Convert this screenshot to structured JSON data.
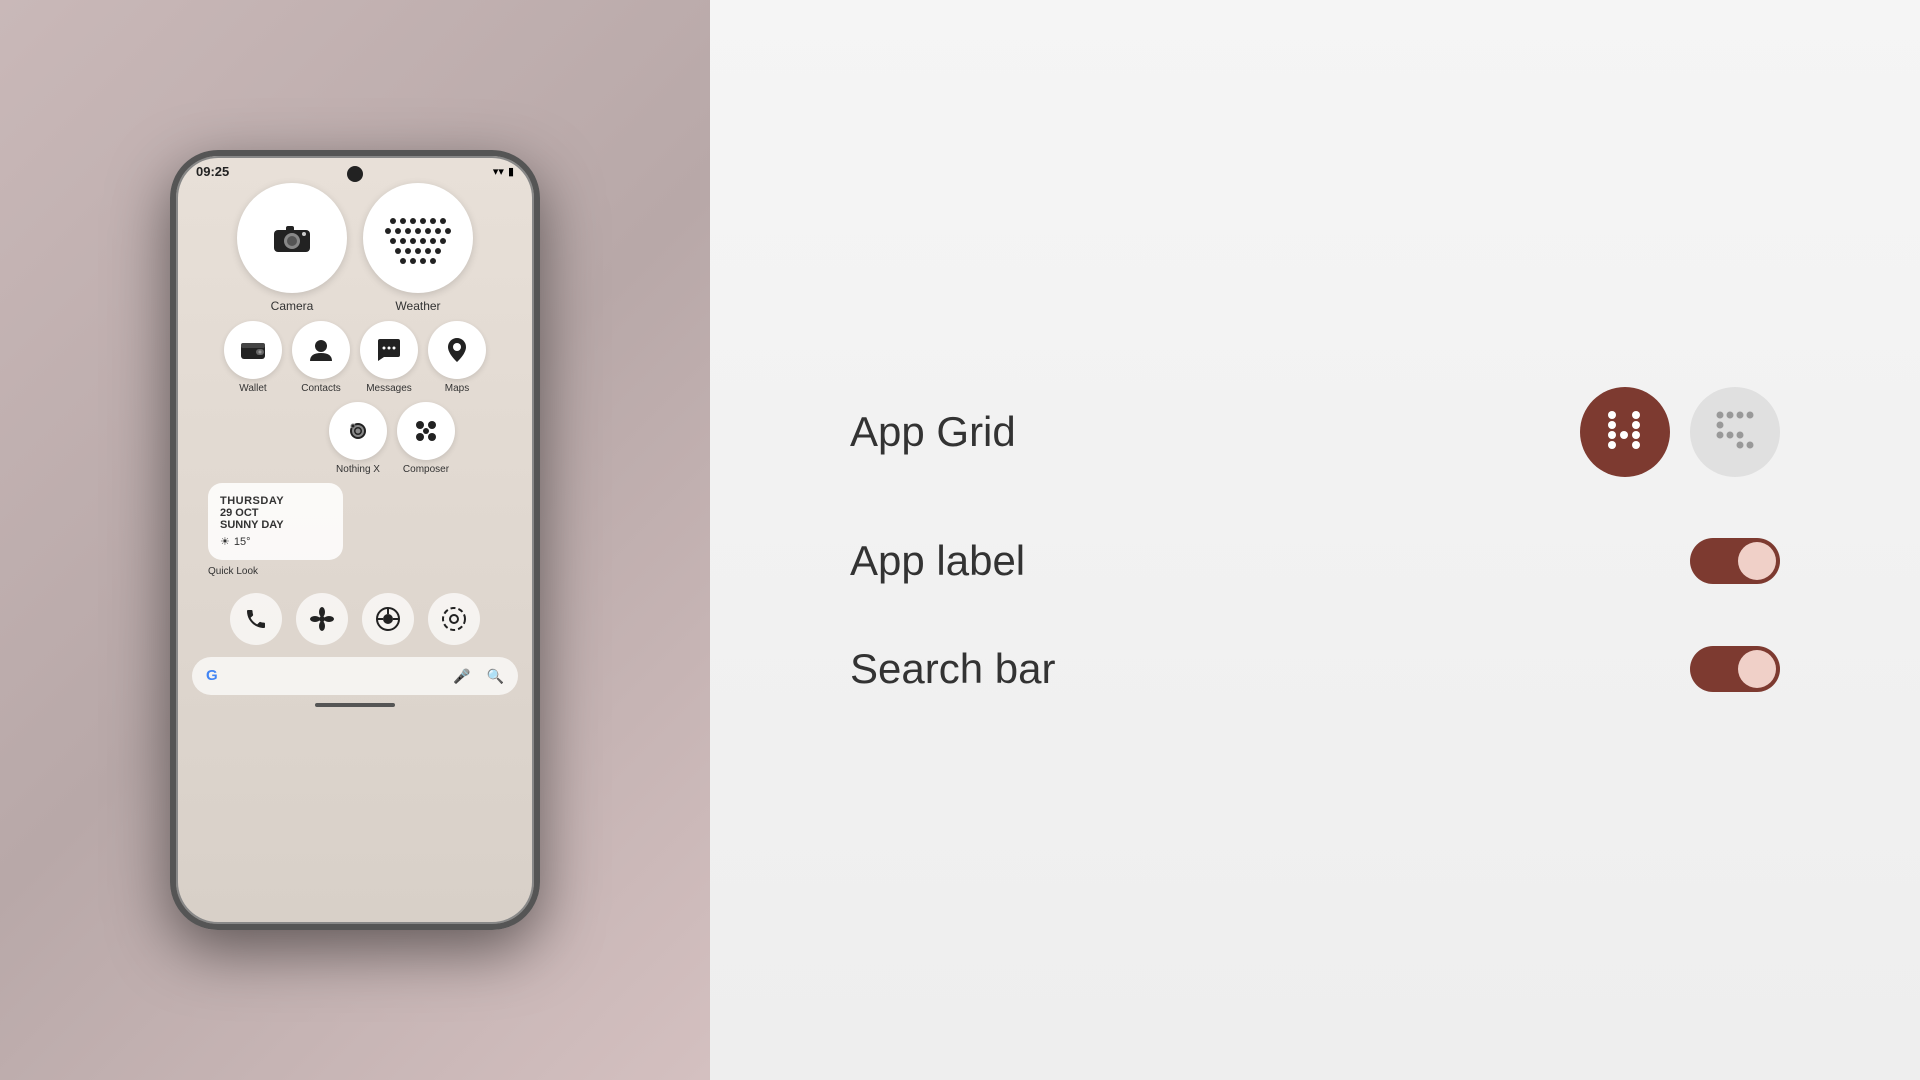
{
  "phone": {
    "time": "09:25",
    "status": {
      "wifi": "▾",
      "battery": "▮"
    },
    "large_apps": [
      {
        "name": "Camera",
        "icon": "camera"
      },
      {
        "name": "Weather",
        "icon": "weather"
      }
    ],
    "medium_apps": [
      {
        "name": "Wallet",
        "icon": "👛"
      },
      {
        "name": "Contacts",
        "icon": "👤"
      },
      {
        "name": "Messages",
        "icon": "💬"
      },
      {
        "name": "Maps",
        "icon": "📍"
      }
    ],
    "row3_apps": [
      {
        "name": "Nothing X",
        "icon": "✦"
      },
      {
        "name": "Composer",
        "icon": "⠿"
      }
    ],
    "quick_look": {
      "day": "THURSDAY",
      "date": "29 OCT",
      "condition": "SUNNY DAY",
      "temp": "15°",
      "label": "Quick Look"
    },
    "dock_apps": [
      {
        "name": "Phone",
        "icon": "📞"
      },
      {
        "name": "Fan",
        "icon": "✿"
      },
      {
        "name": "Chrome",
        "icon": "◉"
      },
      {
        "name": "Settings",
        "icon": "⚙"
      }
    ],
    "search_placeholder": ""
  },
  "settings": {
    "app_grid": {
      "label": "App Grid",
      "option4": "4",
      "option5": "5"
    },
    "app_label": {
      "label": "App label",
      "enabled": true
    },
    "search_bar": {
      "label": "Search bar",
      "enabled": true
    }
  },
  "colors": {
    "accent": "#7d3a30",
    "toggle_thumb": "#f0d0c8",
    "inactive_btn": "#e0e0e0"
  }
}
